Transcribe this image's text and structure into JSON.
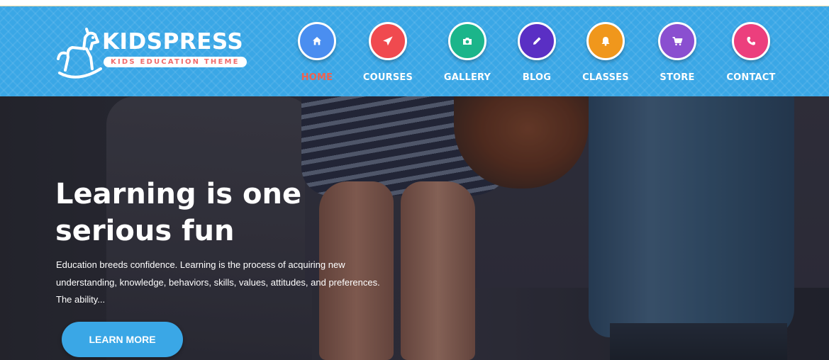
{
  "brand": {
    "name": "KIDSPRESS",
    "tagline": "KIDS EDUCATION THEME",
    "colors": {
      "header": "#3aa7e6",
      "active_nav": "#f0614e",
      "tag_text": "#f06c6c"
    }
  },
  "nav": {
    "items": [
      {
        "label": "HOME",
        "icon": "home-icon",
        "color": "#4a8ef0",
        "active": true
      },
      {
        "label": "COURSES",
        "icon": "paper-plane-icon",
        "color": "#f04a4f",
        "active": false
      },
      {
        "label": "GALLERY",
        "icon": "camera-icon",
        "color": "#1bb58a",
        "active": false
      },
      {
        "label": "BLOG",
        "icon": "pencil-icon",
        "color": "#5a2fc4",
        "active": false
      },
      {
        "label": "CLASSES",
        "icon": "bell-icon",
        "color": "#f0971c",
        "active": false
      },
      {
        "label": "STORE",
        "icon": "cart-icon",
        "color": "#8a4fd0",
        "active": false
      },
      {
        "label": "CONTACT",
        "icon": "phone-icon",
        "color": "#ec3f7d",
        "active": false
      }
    ]
  },
  "hero": {
    "title_line1": "Learning is one",
    "title_line2": "serious fun",
    "text_line1": "Education breeds confidence. Learning is the process of acquiring new",
    "text_line2": "understanding, knowledge, behaviors, skills, values, attitudes, and preferences.",
    "text_line3": "The ability...",
    "cta_label": "LEARN MORE"
  }
}
